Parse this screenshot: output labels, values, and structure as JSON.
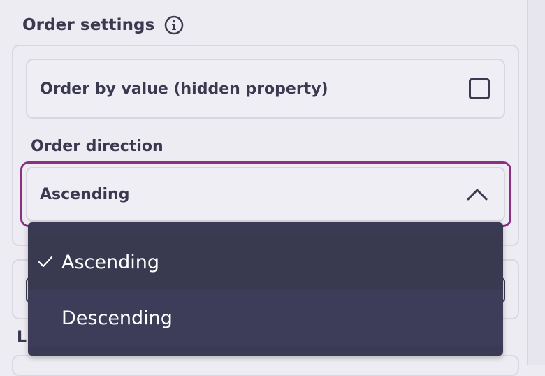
{
  "section": {
    "title": "Order settings",
    "info_icon": "info-circle-icon"
  },
  "order_by_value": {
    "label": "Order by value (hidden property)",
    "checked": false,
    "checkbox_icon": "checkbox-empty-icon"
  },
  "order_direction": {
    "label": "Order direction",
    "selected": "Ascending",
    "expanded": true,
    "chevron_icon": "chevron-up-icon",
    "focus_color": "#8a2f82",
    "options": [
      {
        "label": "Ascending",
        "selected": true,
        "icon": "check-icon"
      },
      {
        "label": "Descending",
        "selected": false
      }
    ]
  },
  "hidden_section": {
    "label_partial": "L"
  },
  "colors": {
    "background": "#edecf2",
    "text": "#3a3950",
    "menu_bg": "#3a3a54",
    "menu_text": "#ffffff"
  }
}
